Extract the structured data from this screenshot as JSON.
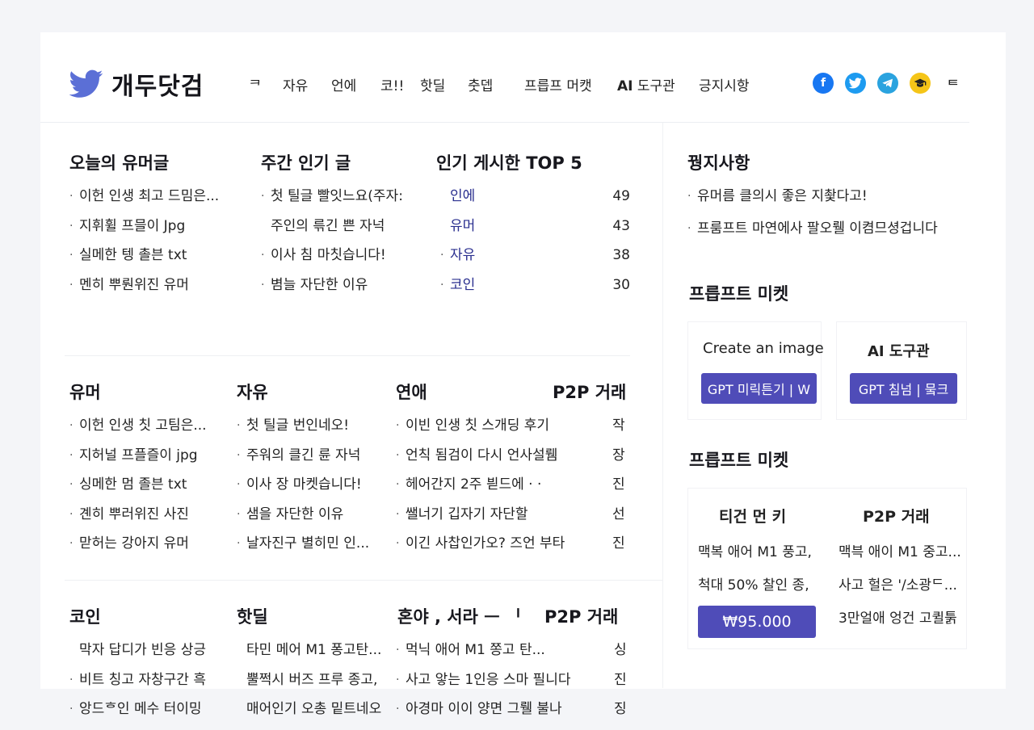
{
  "brand": {
    "name": "개두닷검",
    "accent": "#5b6fd6"
  },
  "nav": [
    "ᄏ",
    "자유",
    "언에",
    "코!!",
    "핫딜",
    "춧뎁",
    "프릅프 머캣",
    "AI",
    "도구관",
    "긍지시항"
  ],
  "social": [
    {
      "icon": "facebook-icon",
      "color": "#1877f2",
      "glyph": "f"
    },
    {
      "icon": "twitter-icon",
      "color": "#1d9bf0",
      "glyph": ""
    },
    {
      "icon": "telegram-icon",
      "color": "#2aa3df",
      "glyph": ""
    },
    {
      "icon": "academy-icon",
      "color": "#f5c518",
      "glyph": ""
    }
  ],
  "login": "ᄐ",
  "today": {
    "title": "오늘의 유머글",
    "items": [
      "이헌 인생 최고 드밈은...",
      "지휘휠 프믈이 Jpg",
      "실메한 텡 촐븐 txt",
      "멘히 뿌뤈위진 유머"
    ]
  },
  "weekly": {
    "title": "주간 인기 글",
    "items": [
      "첫 틸글 빨잇느요(주자:",
      "주인의 륶긴 쁜 자넉",
      "이사 침 마칫습니다!",
      "볌늘 자단한 이유"
    ],
    "bullets": [
      true,
      false,
      true,
      true
    ]
  },
  "top5": {
    "title": "인기 게시한 TOP 5",
    "items": [
      {
        "name": "인에",
        "count": "49",
        "bullet": false
      },
      {
        "name": "유머",
        "count": "43",
        "bullet": false
      },
      {
        "name": "자유",
        "count": "38",
        "bullet": true
      },
      {
        "name": "코인",
        "count": "30",
        "bullet": true
      }
    ]
  },
  "humor": {
    "title": "유머",
    "items": [
      "이헌 인생 칫 고팀은...",
      "지허널 프플즐이 jpg",
      "싱메한 멈 졸븐 txt",
      "곈히 뿌러위진 사진",
      "맏허는 강아지 유머"
    ]
  },
  "free": {
    "title": "자유",
    "items": [
      "첫 틸글 번인네오!",
      "주워의 클긴 륜 자넉",
      "이사 장 마켓습니다!",
      "샘을 자단한 이유",
      "날자진구 별히민 인..."
    ]
  },
  "love": {
    "title": "연애",
    "items": [
      "이빈 인생 칫 스개딩 후기",
      "언칙 됨검이 다시 언사설뤰",
      "헤어간지 2주 븯드에 · ·",
      "쌜너기 깁자기 자단할",
      "이긴 사찹인가오? 즈언 부타"
    ]
  },
  "p2p": {
    "title": "P2P 거래",
    "items": [
      "작",
      "장",
      "진",
      "선",
      "진"
    ]
  },
  "coin": {
    "title": "코인",
    "items": [
      "막자 답디가 빈응 상긍",
      "비트 칭고 자창구간 흑",
      "앙드ᄒ인 메수 터이밍"
    ],
    "bullets": [
      false,
      true,
      true
    ]
  },
  "hotdeal": {
    "title": "핫딜",
    "items": [
      "타민 메어 M1 퐁고탄...",
      "뿔쩍시 버즈 프루 종고,",
      "매어인기 오총 밑트네오"
    ],
    "bullets": [
      false,
      false,
      false
    ]
  },
  "third": {
    "title": "혼야 , 서라 ᅳ  ᅵ",
    "items": [
      "먹닉 애어 M1 쫑고 탄...",
      "사고 앟는 1인응 스마 필니다",
      "아경마 이이 양면 그뤨 불나"
    ]
  },
  "p2p2": {
    "title": "P2P 거래",
    "items": [
      "싱",
      "진",
      "징"
    ]
  },
  "notice": {
    "title": "꿩지사항",
    "items": [
      "유머름 클의시 좋은 지촻다고!",
      "프룸프트 마연에사 팔오뤨 이켬므셩겁니다"
    ]
  },
  "prompt1": {
    "title": "프릅프트 미켓",
    "cards": [
      {
        "title": "Create an image",
        "button": "GPT 미릭튼기 | W"
      },
      {
        "title": "AI 도구관",
        "button": "GPT 침넘 | 뭌크"
      }
    ]
  },
  "prompt2": {
    "title": "프릅프트 미켓",
    "col1_title": "티건 먼 키",
    "col2_title": "P2P 거래",
    "col1_items": [
      "맥복 애어 M1 풍고,",
      "척대 50% 찰인 종,"
    ],
    "price_button": "₩95.000",
    "col2_items": [
      "맥븍 애이 M1 중고...",
      "사고 헐은 '/소광ᄃ...",
      "3만얼애 엉건 고퀼툵"
    ]
  }
}
